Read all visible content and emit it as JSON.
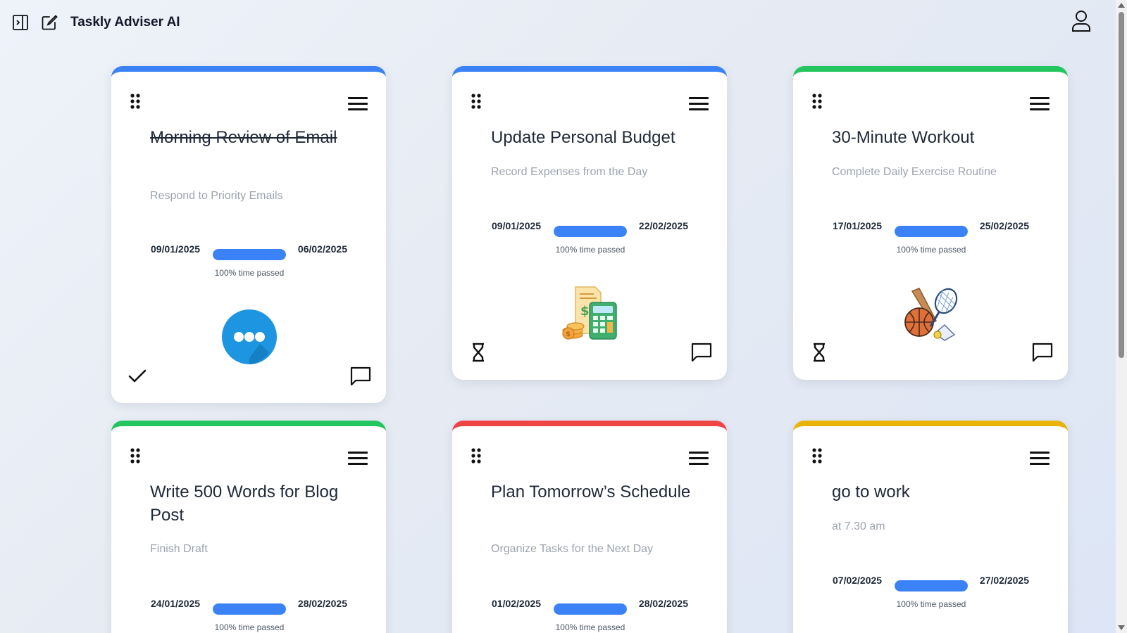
{
  "header": {
    "title": "Taskly Adviser AI",
    "icons": {
      "sidebar": "sidebar-toggle-icon",
      "new": "new-chat-icon",
      "user": "user-icon"
    }
  },
  "colors": {
    "blue": "#3b82f6",
    "green": "#22c55e",
    "red": "#ef4444",
    "yellow": "#eab308",
    "progress": "#3b82f6"
  },
  "cards": [
    {
      "title": "Morning Review of Email",
      "subtitle": "Respond to Priority Emails",
      "start": "09/01/2025",
      "end": "06/02/2025",
      "progress_label": "100% time passed",
      "progress_fraction": 1.0,
      "accent": "#3b82f6",
      "completed": true,
      "status_icon": "checkmark-icon",
      "illustration": "chat-bubble-icon"
    },
    {
      "title": "Update Personal Budget",
      "subtitle": "Record Expenses from the Day",
      "start": "09/01/2025",
      "end": "22/02/2025",
      "progress_label": "100% time passed",
      "progress_fraction": 1.0,
      "accent": "#3b82f6",
      "completed": false,
      "status_icon": "hourglass-icon",
      "illustration": "budget-calculator-icon"
    },
    {
      "title": "30-Minute Workout",
      "subtitle": "Complete Daily Exercise Routine",
      "start": "17/01/2025",
      "end": "25/02/2025",
      "progress_label": "100% time passed",
      "progress_fraction": 1.0,
      "accent": "#22c55e",
      "completed": false,
      "status_icon": "hourglass-icon",
      "illustration": "sports-equipment-icon"
    },
    {
      "title": "Write 500 Words for Blog Post",
      "subtitle": "Finish Draft",
      "start": "24/01/2025",
      "end": "28/02/2025",
      "progress_label": "100% time passed",
      "progress_fraction": 1.0,
      "accent": "#22c55e",
      "completed": false
    },
    {
      "title": "Plan Tomorrow’s Schedule",
      "subtitle": "Organize Tasks for the Next Day",
      "start": "01/02/2025",
      "end": "28/02/2025",
      "progress_label": "100% time passed",
      "progress_fraction": 1.0,
      "accent": "#ef4444",
      "completed": false
    },
    {
      "title": "go to work",
      "subtitle": "at 7.30 am",
      "start": "07/02/2025",
      "end": "27/02/2025",
      "progress_label": "100% time passed",
      "progress_fraction": 1.0,
      "accent": "#eab308",
      "completed": false
    }
  ]
}
